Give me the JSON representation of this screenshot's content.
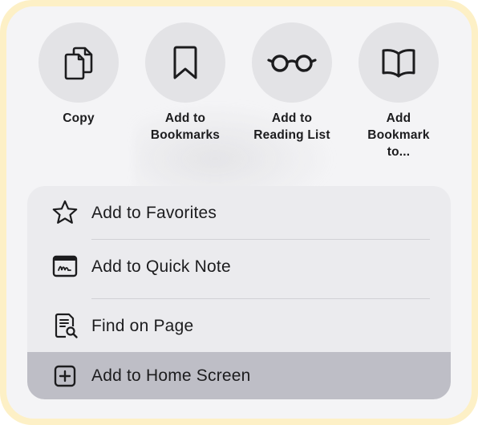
{
  "actions": [
    {
      "label": "Copy",
      "icon": "copy-icon"
    },
    {
      "label": "Add to\nBookmarks",
      "icon": "bookmark-icon"
    },
    {
      "label": "Add to\nReading List",
      "icon": "glasses-icon"
    },
    {
      "label": "Add\nBookmark\nto...",
      "icon": "book-icon"
    }
  ],
  "menu": [
    {
      "label": "Add to Favorites",
      "icon": "star-icon"
    },
    {
      "label": "Add to Quick Note",
      "icon": "quick-note-icon"
    },
    {
      "label": "Find on Page",
      "icon": "find-on-page-icon"
    },
    {
      "label": "Add to Home Screen",
      "icon": "plus-square-icon",
      "highlighted": true
    }
  ],
  "colors": {
    "frame": "#fdf0c6",
    "sheet": "#f4f4f6",
    "circle": "#e3e3e6",
    "menu": "#ebebee",
    "highlight": "#bebec6",
    "text": "#1c1c1e"
  }
}
